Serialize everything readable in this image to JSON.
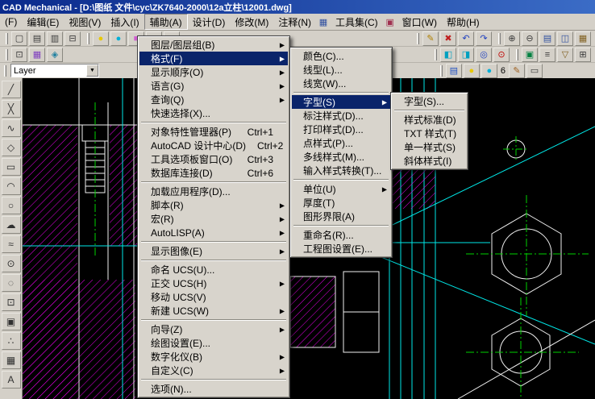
{
  "colors": {
    "titlebar": "#0a2a8c",
    "chrome": "#d4d0c8",
    "menu_highlight": "#0a246a",
    "canvas_bg": "#000000",
    "hatch_magenta": "#e800e8",
    "line_cyan": "#00e8e8",
    "line_white": "#f0f0f0",
    "centerline_green": "#00d200"
  },
  "titlebar": {
    "title": "CAD Mechanical - [D:\\图纸 文件\\cyc\\ZK7640-2000\\12a立柱\\12001.dwg]"
  },
  "menubar": {
    "items": [
      {
        "type": "item",
        "label": "(F)",
        "name": "file"
      },
      {
        "type": "item",
        "label": "编辑(E)",
        "name": "edit"
      },
      {
        "type": "item",
        "label": "视图(V)",
        "name": "view"
      },
      {
        "type": "item",
        "label": "插入(I)",
        "name": "insert"
      },
      {
        "type": "item",
        "label": "辅助(A)",
        "name": "assist",
        "pressed": true
      },
      {
        "type": "item",
        "label": "设计(D)",
        "name": "design"
      },
      {
        "type": "item",
        "label": "修改(M)",
        "name": "modify"
      },
      {
        "type": "item",
        "label": "注释(N)",
        "name": "annotate"
      },
      {
        "type": "icon",
        "name": "grid-menu-icon",
        "glyph": "▦",
        "color": "#3050a0"
      },
      {
        "type": "item",
        "label": "工具集(C)",
        "name": "toolset"
      },
      {
        "type": "icon",
        "name": "box-menu-icon",
        "glyph": "▣",
        "color": "#a03050"
      },
      {
        "type": "item",
        "label": "窗口(W)",
        "name": "window"
      },
      {
        "type": "item",
        "label": "帮助(H)",
        "name": "help"
      }
    ]
  },
  "assist_menu": {
    "items": [
      {
        "label": "图层/图层组(B)",
        "arrow": true
      },
      {
        "label": "格式(F)",
        "arrow": true,
        "highlight": true
      },
      {
        "label": "显示顺序(O)",
        "arrow": true
      },
      {
        "label": "语言(G)",
        "arrow": true
      },
      {
        "label": "查询(Q)",
        "arrow": true
      },
      {
        "label": "快速选择(X)..."
      },
      {
        "sep": true
      },
      {
        "label": "对象特性管理器(P)",
        "shortcut": "Ctrl+1"
      },
      {
        "label": "AutoCAD 设计中心(D)",
        "shortcut": "Ctrl+2"
      },
      {
        "label": "工具选项板窗口(O)",
        "shortcut": "Ctrl+3"
      },
      {
        "label": "数据库连接(D)",
        "shortcut": "Ctrl+6"
      },
      {
        "sep": true
      },
      {
        "label": "加载应用程序(D)..."
      },
      {
        "label": "脚本(R)",
        "arrow": true
      },
      {
        "label": "宏(R)",
        "arrow": true
      },
      {
        "label": "AutoLISP(A)",
        "arrow": true
      },
      {
        "sep": true
      },
      {
        "label": "显示图像(E)",
        "arrow": true
      },
      {
        "sep": true
      },
      {
        "label": "命名 UCS(U)..."
      },
      {
        "label": "正交 UCS(H)",
        "arrow": true
      },
      {
        "label": "移动 UCS(V)"
      },
      {
        "label": "新建 UCS(W)",
        "arrow": true
      },
      {
        "sep": true
      },
      {
        "label": "向导(Z)",
        "arrow": true
      },
      {
        "label": "绘图设置(E)..."
      },
      {
        "label": "数字化仪(B)",
        "arrow": true
      },
      {
        "label": "自定义(C)",
        "arrow": true
      },
      {
        "sep": true
      },
      {
        "label": "选项(N)..."
      }
    ]
  },
  "format_menu": {
    "items": [
      {
        "label": "颜色(C)..."
      },
      {
        "label": "线型(L)..."
      },
      {
        "label": "线宽(W)..."
      },
      {
        "sep": true
      },
      {
        "label": "字型(S)",
        "arrow": true,
        "highlight": true
      },
      {
        "label": "标注样式(D)..."
      },
      {
        "label": "打印样式(D)..."
      },
      {
        "label": "点样式(P)..."
      },
      {
        "label": "多线样式(M)..."
      },
      {
        "label": "输入样式转换(T)..."
      },
      {
        "sep": true
      },
      {
        "label": "单位(U)",
        "arrow": true
      },
      {
        "label": "厚度(T)"
      },
      {
        "label": "图形界限(A)"
      },
      {
        "sep": true
      },
      {
        "label": "重命名(R)..."
      },
      {
        "label": "工程图设置(E)..."
      }
    ]
  },
  "style_menu": {
    "items": [
      {
        "label": "字型(S)..."
      },
      {
        "sep": true
      },
      {
        "label": "样式标准(D)"
      },
      {
        "label": "TXT 样式(T)"
      },
      {
        "label": "单一样式(S)"
      },
      {
        "label": "斜体样式(I)"
      }
    ]
  },
  "layer_combo": {
    "value": "Layer",
    "dropdown_glyph": "▼"
  },
  "toolbars": {
    "row1_left": [
      {
        "buttons": [
          {
            "name": "new",
            "glyph": "▢"
          },
          {
            "name": "open",
            "glyph": "▤"
          },
          {
            "name": "save",
            "glyph": "▥"
          },
          {
            "name": "plot",
            "glyph": "⊟"
          }
        ]
      },
      {
        "buttons": [
          {
            "name": "lamp-on",
            "glyph": "●",
            "color": "#e8c800"
          },
          {
            "name": "lamp-freeze",
            "glyph": "●",
            "color": "#00b0d8"
          },
          {
            "name": "swatch-magenta",
            "glyph": "■",
            "color": "#d060d0"
          },
          {
            "name": "swatch-blue",
            "glyph": "■",
            "color": "#6088d0"
          },
          {
            "name": "swatch-white",
            "glyph": "■",
            "color": "#ffffff"
          }
        ]
      }
    ],
    "row1_right": [
      {
        "buttons": [
          {
            "name": "edit-pencil",
            "glyph": "✎",
            "color": "#b08000"
          },
          {
            "name": "erase",
            "glyph": "✖",
            "color": "#c02020"
          },
          {
            "name": "undo",
            "glyph": "↶",
            "color": "#2040c0"
          },
          {
            "name": "redo",
            "glyph": "↷",
            "color": "#2040c0"
          }
        ]
      },
      {
        "buttons": [
          {
            "name": "zoom-in",
            "glyph": "⊕"
          },
          {
            "name": "zoom-out",
            "glyph": "⊖"
          },
          {
            "name": "layer-sheet",
            "glyph": "▤",
            "color": "#3050a0"
          },
          {
            "name": "layer-copy",
            "glyph": "◫",
            "color": "#3050a0"
          },
          {
            "name": "hatch-tool",
            "glyph": "▦",
            "color": "#806020"
          }
        ]
      }
    ],
    "row2_left": [
      {
        "buttons": [
          {
            "name": "block-insert",
            "glyph": "⊡"
          },
          {
            "name": "hatch-edit",
            "glyph": "▦",
            "color": "#8040c0"
          },
          {
            "name": "object-snap",
            "glyph": "◈",
            "color": "#2080a0"
          }
        ]
      }
    ],
    "row2_right": [
      {
        "buttons": [
          {
            "name": "view-left",
            "glyph": "◧",
            "color": "#00a0c0"
          },
          {
            "name": "view-right",
            "glyph": "◨",
            "color": "#00a0c0"
          },
          {
            "name": "target",
            "glyph": "◎",
            "color": "#2040c0"
          },
          {
            "name": "center-mark",
            "glyph": "⊙",
            "color": "#c00000"
          }
        ]
      },
      {
        "buttons": [
          {
            "name": "block-def",
            "glyph": "▣",
            "color": "#008040"
          },
          {
            "name": "list",
            "glyph": "≡"
          },
          {
            "name": "triangle-tool",
            "glyph": "▽",
            "color": "#806020"
          },
          {
            "name": "grid-tool",
            "glyph": "⊞"
          }
        ]
      }
    ],
    "row3_right": [
      {
        "buttons": [
          {
            "name": "layer-stack",
            "glyph": "▤",
            "color": "#2050c0"
          },
          {
            "name": "layergroup-lamp-on",
            "glyph": "●",
            "color": "#e8c800"
          },
          {
            "name": "layergroup-lamp-freeze",
            "glyph": "●",
            "color": "#00b0d8"
          },
          {
            "name": "layergroup-count",
            "type": "label",
            "label": "6"
          },
          {
            "name": "layer-pencil",
            "glyph": "✎",
            "color": "#a06020"
          },
          {
            "name": "layer-box",
            "glyph": "▭"
          }
        ]
      }
    ],
    "left": [
      {
        "buttons": [
          {
            "name": "line",
            "glyph": "╱"
          },
          {
            "name": "construction-line",
            "glyph": "╳"
          },
          {
            "name": "polyline",
            "glyph": "∿"
          },
          {
            "name": "polygon",
            "glyph": "◇"
          },
          {
            "name": "rectangle",
            "glyph": "▭"
          },
          {
            "name": "arc",
            "glyph": "◠"
          },
          {
            "name": "circle",
            "glyph": "○"
          },
          {
            "name": "revision-cloud",
            "glyph": "☁"
          },
          {
            "name": "spline",
            "glyph": "≈"
          },
          {
            "name": "ellipse",
            "glyph": "⊙"
          },
          {
            "name": "ellipse-arc",
            "glyph": "◌"
          },
          {
            "name": "insert-block",
            "glyph": "⊡"
          },
          {
            "name": "make-block",
            "glyph": "▣"
          },
          {
            "name": "point",
            "glyph": "∴"
          },
          {
            "name": "hatch",
            "glyph": "▦"
          },
          {
            "name": "mtext",
            "glyph": "A"
          }
        ]
      }
    ]
  }
}
